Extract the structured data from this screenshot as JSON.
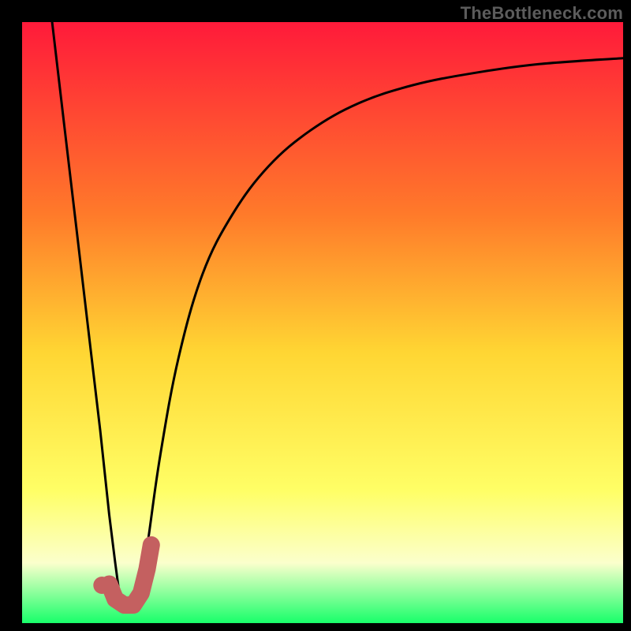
{
  "watermark": {
    "text": "TheBottleneck.com"
  },
  "colors": {
    "frame_bg": "#000000",
    "gradient_top": "#ff1a3a",
    "gradient_mid1": "#ff7a2a",
    "gradient_mid2": "#ffd633",
    "gradient_mid3": "#ffff66",
    "gradient_pale": "#fbffcc",
    "gradient_bottom": "#18ff6a",
    "curve": "#000000",
    "marker_fill": "#c46060",
    "marker_stroke": "#b04f4f"
  },
  "chart_data": {
    "type": "line",
    "title": "",
    "xlabel": "",
    "ylabel": "",
    "xlim": [
      0,
      100
    ],
    "ylim": [
      0,
      100
    ],
    "series": [
      {
        "name": "left-descent",
        "x": [
          5,
          7,
          9,
          11,
          13,
          14.5,
          15.5,
          16.3
        ],
        "y": [
          100,
          83,
          66,
          49,
          32,
          18,
          10,
          4
        ]
      },
      {
        "name": "right-ascent",
        "x": [
          19.5,
          21,
          23,
          26,
          30,
          35,
          41,
          48,
          56,
          65,
          75,
          86,
          100
        ],
        "y": [
          4,
          14,
          28,
          44,
          58,
          68,
          76,
          82,
          86.5,
          89.5,
          91.5,
          93,
          94
        ]
      }
    ],
    "marker": {
      "name": "optimal-point-hook",
      "points": [
        {
          "x": 14.5,
          "y": 6.5
        },
        {
          "x": 15.5,
          "y": 4.0
        },
        {
          "x": 17.0,
          "y": 3.0
        },
        {
          "x": 18.5,
          "y": 3.0
        },
        {
          "x": 19.8,
          "y": 5.0
        },
        {
          "x": 20.8,
          "y": 9.0
        },
        {
          "x": 21.5,
          "y": 13.0
        }
      ],
      "dot": {
        "x": 13.3,
        "y": 6.3
      }
    }
  }
}
